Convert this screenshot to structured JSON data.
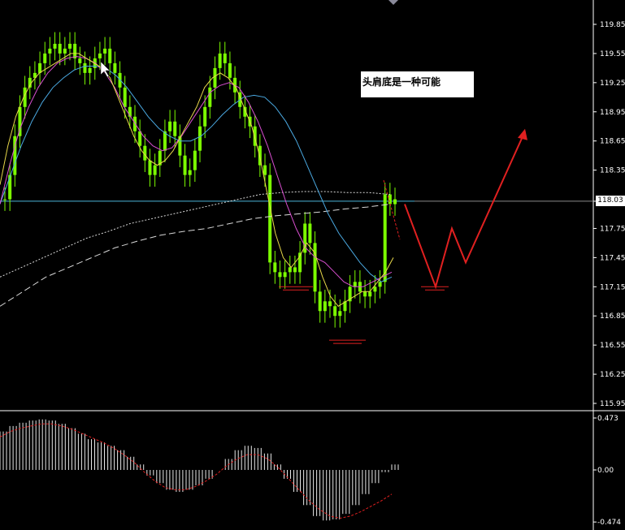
{
  "colors": {
    "background": "#000000",
    "candle": "#7CFC00",
    "ma_yellow": "#e8d84a",
    "ma_magenta": "#d94fd0",
    "ma_blue": "#4aa8e0",
    "ma_white": "#d8d8d8",
    "hline": "#4cb4d8",
    "projection": "#e02020",
    "macd_bars": "#e8e8e8",
    "signal": "#e02020"
  },
  "annotation": {
    "text": "头肩底是一种可能"
  },
  "current_price": "118.03",
  "chart_data": [
    {
      "type": "candlestick",
      "title": "",
      "ylim": [
        115.95,
        120.05
      ],
      "yticks": [
        "119.85",
        "119.55",
        "119.25",
        "118.95",
        "118.65",
        "118.35",
        "118.03",
        "117.75",
        "117.45",
        "117.15",
        "116.85",
        "116.55",
        "116.25",
        "115.95"
      ],
      "horizontal_line": 118.03,
      "closes": [
        118.05,
        118.3,
        118.7,
        119.0,
        119.2,
        119.3,
        119.35,
        119.45,
        119.55,
        119.6,
        119.65,
        119.55,
        119.6,
        119.65,
        119.5,
        119.45,
        119.35,
        119.4,
        119.5,
        119.55,
        119.6,
        119.45,
        119.35,
        119.2,
        119.0,
        118.9,
        118.75,
        118.6,
        118.45,
        118.3,
        118.4,
        118.55,
        118.75,
        118.85,
        118.7,
        118.5,
        118.3,
        118.35,
        118.55,
        118.8,
        119.0,
        119.2,
        119.4,
        119.55,
        119.45,
        119.3,
        119.15,
        119.0,
        118.9,
        118.8,
        118.6,
        118.4,
        118.3,
        117.4,
        117.3,
        117.25,
        117.3,
        117.35,
        117.3,
        117.5,
        117.8,
        117.6,
        117.1,
        116.9,
        117.0,
        116.95,
        116.85,
        116.9,
        117.0,
        117.15,
        117.2,
        117.1,
        117.05,
        117.1,
        117.15,
        117.2,
        118.1,
        118.0,
        118.05
      ],
      "ma_yellow": [
        118.2,
        118.6,
        118.9,
        119.1,
        119.25,
        119.35,
        119.4,
        119.45,
        119.5,
        119.55,
        119.55,
        119.5,
        119.45,
        119.4,
        119.3,
        119.1,
        118.9,
        118.7,
        118.55,
        118.45,
        118.4,
        118.45,
        118.55,
        118.7,
        118.85,
        119.0,
        119.2,
        119.3,
        119.35,
        119.3,
        119.2,
        119.0,
        118.8,
        118.5,
        118.1,
        117.7,
        117.45,
        117.35,
        117.45,
        117.6,
        117.5,
        117.25,
        117.05,
        116.95,
        117.0,
        117.05,
        117.1,
        117.1,
        117.2,
        117.3,
        117.45
      ],
      "ma_magenta": [
        118.0,
        118.4,
        118.75,
        119.0,
        119.2,
        119.35,
        119.45,
        119.5,
        119.52,
        119.5,
        119.45,
        119.35,
        119.2,
        119.0,
        118.85,
        118.7,
        118.6,
        118.55,
        118.58,
        118.7,
        118.85,
        119.0,
        119.15,
        119.22,
        119.25,
        119.2,
        119.05,
        118.85,
        118.6,
        118.3,
        118.0,
        117.75,
        117.55,
        117.45,
        117.4,
        117.3,
        117.2,
        117.15,
        117.15,
        117.2,
        117.25,
        117.3
      ],
      "ma_blue": [
        118.0,
        118.3,
        118.6,
        118.85,
        119.05,
        119.2,
        119.3,
        119.38,
        119.42,
        119.42,
        119.4,
        119.32,
        119.2,
        119.05,
        118.9,
        118.78,
        118.7,
        118.65,
        118.65,
        118.7,
        118.8,
        118.92,
        119.02,
        119.1,
        119.12,
        119.1,
        119.0,
        118.85,
        118.65,
        118.4,
        118.15,
        117.9,
        117.7,
        117.55,
        117.4,
        117.28,
        117.2,
        117.25
      ],
      "ma_white_dotted": [
        117.25,
        117.35,
        117.45,
        117.55,
        117.65,
        117.72,
        117.8,
        117.85,
        117.9,
        117.95,
        118.0,
        118.05,
        118.1,
        118.12,
        118.13,
        118.13,
        118.12,
        118.12,
        118.1
      ],
      "ma_white_dashed": [
        116.95,
        117.1,
        117.25,
        117.35,
        117.45,
        117.55,
        117.62,
        117.68,
        117.72,
        117.75,
        117.8,
        117.85,
        117.88,
        117.9,
        117.92,
        117.95,
        117.97,
        118.0
      ],
      "support_levels": [
        117.15,
        116.6,
        117.15
      ],
      "projection": [
        118.0,
        117.15,
        117.75,
        117.4,
        118.75
      ]
    },
    {
      "type": "bar",
      "title": "",
      "ylim": [
        -0.474,
        0.473
      ],
      "yticks": [
        "0.473",
        "0.00",
        "-0.474"
      ],
      "macd": [
        0.35,
        0.4,
        0.43,
        0.45,
        0.46,
        0.45,
        0.42,
        0.38,
        0.33,
        0.28,
        0.25,
        0.22,
        0.18,
        0.12,
        0.05,
        -0.05,
        -0.12,
        -0.18,
        -0.2,
        -0.18,
        -0.14,
        -0.08,
        0.0,
        0.1,
        0.18,
        0.22,
        0.2,
        0.15,
        0.05,
        -0.08,
        -0.2,
        -0.32,
        -0.42,
        -0.46,
        -0.45,
        -0.4,
        -0.32,
        -0.22,
        -0.12,
        -0.02,
        0.05
      ],
      "signal": [
        0.3,
        0.35,
        0.38,
        0.4,
        0.42,
        0.42,
        0.4,
        0.37,
        0.33,
        0.29,
        0.25,
        0.2,
        0.14,
        0.07,
        -0.02,
        -0.1,
        -0.16,
        -0.18,
        -0.18,
        -0.15,
        -0.1,
        -0.04,
        0.04,
        0.1,
        0.14,
        0.14,
        0.1,
        0.02,
        -0.08,
        -0.18,
        -0.28,
        -0.36,
        -0.42,
        -0.44,
        -0.42,
        -0.38,
        -0.33,
        -0.28,
        -0.22
      ]
    }
  ]
}
